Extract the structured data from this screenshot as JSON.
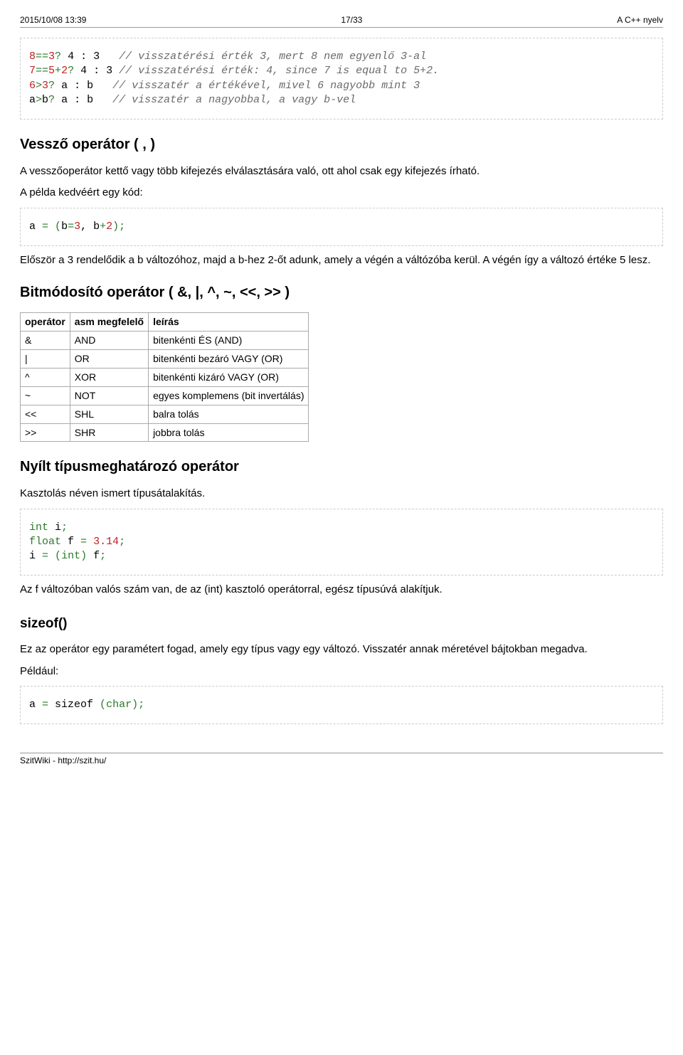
{
  "header": {
    "left": "2015/10/08 13:39",
    "center": "17/33",
    "right": "A C++ nyelv"
  },
  "footer": {
    "text": "SzitWiki - http://szit.hu/"
  },
  "code_block1": {
    "l1a": "8",
    "l1b": "==",
    "l1c": "3",
    "l1d": "?",
    "l1e": " 4 : 3",
    "l1cmt": "   // visszatérési érték 3, mert 8 nem egyenlő 3-al",
    "l2a": "7",
    "l2b": "==",
    "l2c": "5",
    "l2d": "+",
    "l2e": "2",
    "l2f": "?",
    "l2g": " 4 : 3",
    "l2cmt": " // visszatérési érték: 4, since 7 is equal to 5+2.",
    "l3a": "6",
    "l3b": ">",
    "l3c": "3",
    "l3d": "?",
    "l3e": " a : b",
    "l3cmt": "   // visszatér a értékével, mivel 6 nagyobb mint 3",
    "l4a": "a",
    "l4b": ">",
    "l4c": "b",
    "l4d": "?",
    "l4e": " a : b",
    "l4cmt": "   // visszatér a nagyobbal, a vagy b-vel"
  },
  "heading_comma": "Vessző operátor ( , )",
  "para_comma": "A vesszőoperátor kettő vagy több kifejezés elválasztására való, ott ahol csak egy kifejezés írható.",
  "para_example_intro": "A példa kedvéért egy kód:",
  "code_block2": {
    "a": "a ",
    "eq": "=",
    "sp": " ",
    "lp": "(",
    "b": "b",
    "eq2": "=",
    "n1": "3",
    "comma": ", b",
    "plus": "+",
    "n2": "2",
    "rp": ")",
    "semi": ";"
  },
  "para_after_code2": "Először a 3 rendelődik a b változóhoz, majd a b-hez 2-őt adunk, amely a végén a váltózóba kerül. A végén így a változó értéke 5 lesz.",
  "heading_bitmod": "Bitmódosító operátor ( &, |, ^, ~, <<, >> )",
  "table": {
    "h1": "operátor",
    "h2": "asm megfelelő",
    "h3": "leírás",
    "rows": [
      {
        "c1": "&",
        "c2": "AND",
        "c3": "bitenkénti ÉS (AND)"
      },
      {
        "c1": "|",
        "c2": "OR",
        "c3": "bitenkénti bezáró VAGY (OR)"
      },
      {
        "c1": "^",
        "c2": "XOR",
        "c3": "bitenkénti kizáró VAGY (OR)"
      },
      {
        "c1": "~",
        "c2": "NOT",
        "c3": "egyes komplemens (bit invertálás)"
      },
      {
        "c1": "<<",
        "c2": "SHL",
        "c3": "balra tolás"
      },
      {
        "c1": ">>",
        "c2": "SHR",
        "c3": "jobbra tolás"
      }
    ]
  },
  "heading_cast": "Nyílt típusmeghatározó operátor",
  "para_cast": "Kasztolás néven ismert típusátalakítás.",
  "code_block3": {
    "l1a": "int",
    "l1b": " i",
    "l1c": ";",
    "l2a": "float",
    "l2b": " f ",
    "l2c": "=",
    "l2d": " ",
    "l2e": "3.14",
    "l2f": ";",
    "l3a": "i ",
    "l3b": "=",
    "l3c": " ",
    "l3d": "(",
    "l3e": "int",
    "l3f": ")",
    "l3g": " f",
    "l3h": ";"
  },
  "para_cast_after": "Az f változóban valós szám van, de az (int) kasztoló operátorral, egész típusúvá alakítjuk.",
  "heading_sizeof": "sizeof()",
  "para_sizeof": "Ez az operátor egy paramétert fogad, amely egy típus vagy egy változó. Visszatér annak méretével bájtokban megadva.",
  "para_example2": "Például:",
  "code_block4": {
    "a": "a ",
    "eq": "=",
    "sp": " sizeof ",
    "lp": "(",
    "t": "char",
    "rp": ")",
    "semi": ";"
  }
}
